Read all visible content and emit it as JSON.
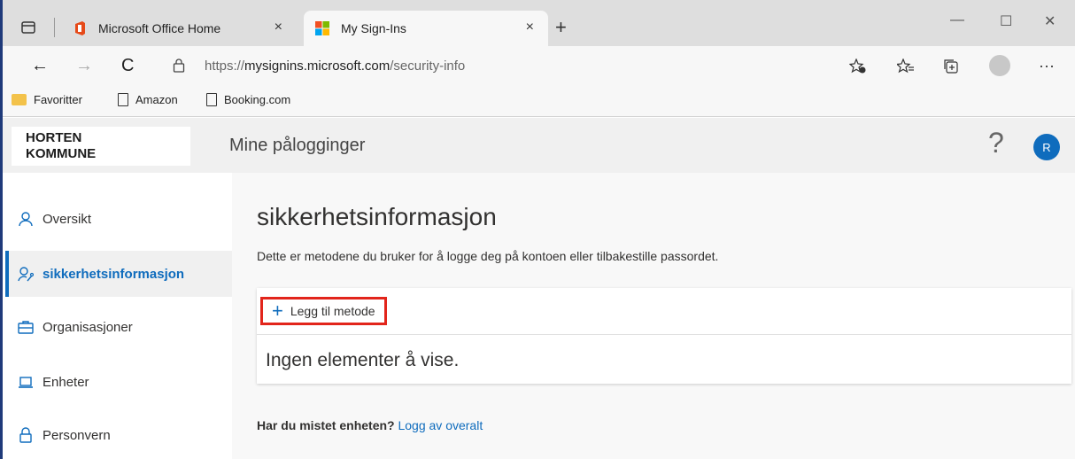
{
  "browser": {
    "tabs": [
      {
        "title": "Microsoft Office Home",
        "close": "×",
        "active": false
      },
      {
        "title": "My Sign-Ins",
        "close": "×",
        "active": true
      }
    ],
    "new_tab": "+",
    "window_controls": {
      "minimize": "—",
      "maximize": "☐",
      "close": "✕"
    },
    "nav": {
      "back": "←",
      "forward": "→",
      "refresh": "C"
    },
    "url": {
      "prefix": "https://",
      "host": "mysignins.microsoft.com",
      "path": "/security-info"
    },
    "more": "···",
    "favorites": [
      {
        "label": "Favoritter",
        "icon": "folder-icon"
      },
      {
        "label": "Amazon",
        "icon": "page-icon"
      },
      {
        "label": "Booking.com",
        "icon": "page-icon"
      }
    ]
  },
  "header": {
    "org_line1": "HORTEN",
    "org_line2": "KOMMUNE",
    "title": "Mine pålogginger",
    "help": "?",
    "user_initial": "R"
  },
  "sidebar": {
    "items": [
      {
        "label": "Oversikt",
        "icon": "person-icon",
        "active": false
      },
      {
        "label": "sikkerhetsinformasjon",
        "icon": "person-key-icon",
        "active": true
      },
      {
        "label": "Organisasjoner",
        "icon": "briefcase-icon",
        "active": false
      },
      {
        "label": "Enheter",
        "icon": "laptop-icon",
        "active": false
      },
      {
        "label": "Personvern",
        "icon": "lock-icon",
        "active": false
      }
    ]
  },
  "main": {
    "title": "sikkerhetsinformasjon",
    "description": "Dette er metodene du bruker for å logge deg på kontoen eller tilbakestille passordet.",
    "add_method": "Legg til metode",
    "empty": "Ingen elementer å vise.",
    "lost_device": "Har du mistet enheten?",
    "sign_out_everywhere": "Logg av overalt"
  },
  "colors": {
    "accent": "#0f6cbd",
    "highlight": "#e2251b"
  }
}
